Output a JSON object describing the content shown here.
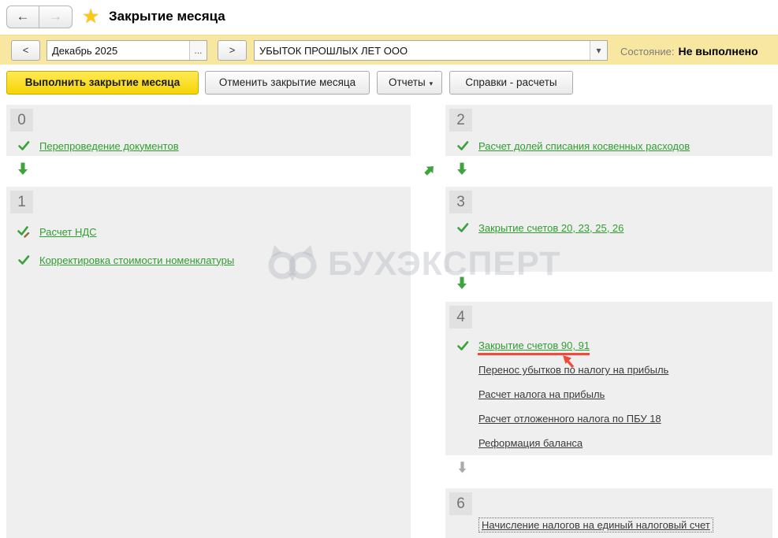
{
  "header": {
    "title": "Закрытие месяца",
    "back_label": "←",
    "forward_label": "→"
  },
  "toolbar": {
    "prev_label": "<",
    "next_label": ">",
    "period_value": "Декабрь 2025",
    "period_picker_label": "...",
    "company_value": "УБЫТОК ПРОШЛЫХ ЛЕТ ООО",
    "company_dropdown_label": "▾",
    "status_label": "Состояние:",
    "status_value": "Не выполнено"
  },
  "actions": {
    "perform_label": "Выполнить закрытие месяца",
    "cancel_label": "Отменить закрытие месяца",
    "reports_label": "Отчеты",
    "reports_caret": "▾",
    "references_label": "Справки - расчеты"
  },
  "sections": {
    "s0": {
      "number": "0",
      "items": [
        {
          "label": "Перепроведение документов",
          "state": "done"
        }
      ]
    },
    "s1": {
      "number": "1",
      "items": [
        {
          "label": "Расчет НДС",
          "state": "done-manual"
        },
        {
          "label": "Корректировка стоимости номенклатуры",
          "state": "done"
        }
      ]
    },
    "s2": {
      "number": "2",
      "items": [
        {
          "label": "Расчет долей списания косвенных расходов",
          "state": "done"
        }
      ]
    },
    "s3": {
      "number": "3",
      "items": [
        {
          "label": "Закрытие счетов 20, 23, 25, 26",
          "state": "done"
        }
      ]
    },
    "s4": {
      "number": "4",
      "items": [
        {
          "label": "Закрытие счетов 90, 91",
          "state": "done",
          "annotated": true
        },
        {
          "label": "Перенос убытков по налогу на прибыль",
          "state": "pending"
        },
        {
          "label": "Расчет налога на прибыль",
          "state": "pending"
        },
        {
          "label": "Расчет отложенного налога по ПБУ 18",
          "state": "pending"
        },
        {
          "label": "Реформация баланса",
          "state": "pending"
        }
      ]
    },
    "s6": {
      "number": "6",
      "items": [
        {
          "label": "Начисление налогов на единый налоговый счет",
          "state": "focused"
        }
      ]
    }
  },
  "watermark": {
    "text": "БУХЭКСПЕРТ"
  },
  "colors": {
    "toolbar_bg": "#f8e7a1",
    "primary_button_bg": "#f9d90e",
    "panel_bg": "#efefef",
    "number_box_bg": "#e1e1e1",
    "done_green": "#2f9e2f",
    "pending_text": "#3a3a3a",
    "annotation_red": "#f04a3a",
    "star_gold": "#fcc81d"
  }
}
